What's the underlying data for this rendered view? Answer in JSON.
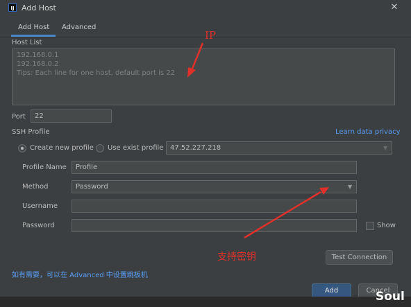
{
  "window": {
    "title": "Add Host",
    "app_icon_text": "IJ"
  },
  "tabs": [
    {
      "label": "Add Host",
      "active": true
    },
    {
      "label": "Advanced",
      "active": false
    }
  ],
  "host_list": {
    "label": "Host List",
    "lines": [
      "192.168.0.1",
      "192.168.0.2",
      "Tips: Each line for one host, default port is 22"
    ]
  },
  "port": {
    "label": "Port",
    "value": "22"
  },
  "ssh_profile": {
    "label": "SSH Profile",
    "privacy_link": "Learn data privacy",
    "create_new_label": "Create new profile",
    "use_exist_label": "Use exist profile",
    "selected_mode": "create_new",
    "existing_value": "47.52.227.218"
  },
  "profile": {
    "name_label": "Profile Name",
    "name_value": "Profile",
    "method_label": "Method",
    "method_value": "Password",
    "username_label": "Username",
    "username_value": "",
    "password_label": "Password",
    "password_value": "",
    "show_label": "Show"
  },
  "buttons": {
    "test_connection": "Test Connection",
    "add": "Add",
    "cancel": "Cancel"
  },
  "hint": "如有需要，可以在 Advanced 中设置跳板机",
  "annotations": {
    "ip": "IP",
    "key_support": "支持密钥"
  },
  "watermark": "Soul",
  "colors": {
    "accent": "#365880",
    "link": "#589df6",
    "annotation": "#e0302a",
    "tab_underline": "#4a88c7"
  }
}
